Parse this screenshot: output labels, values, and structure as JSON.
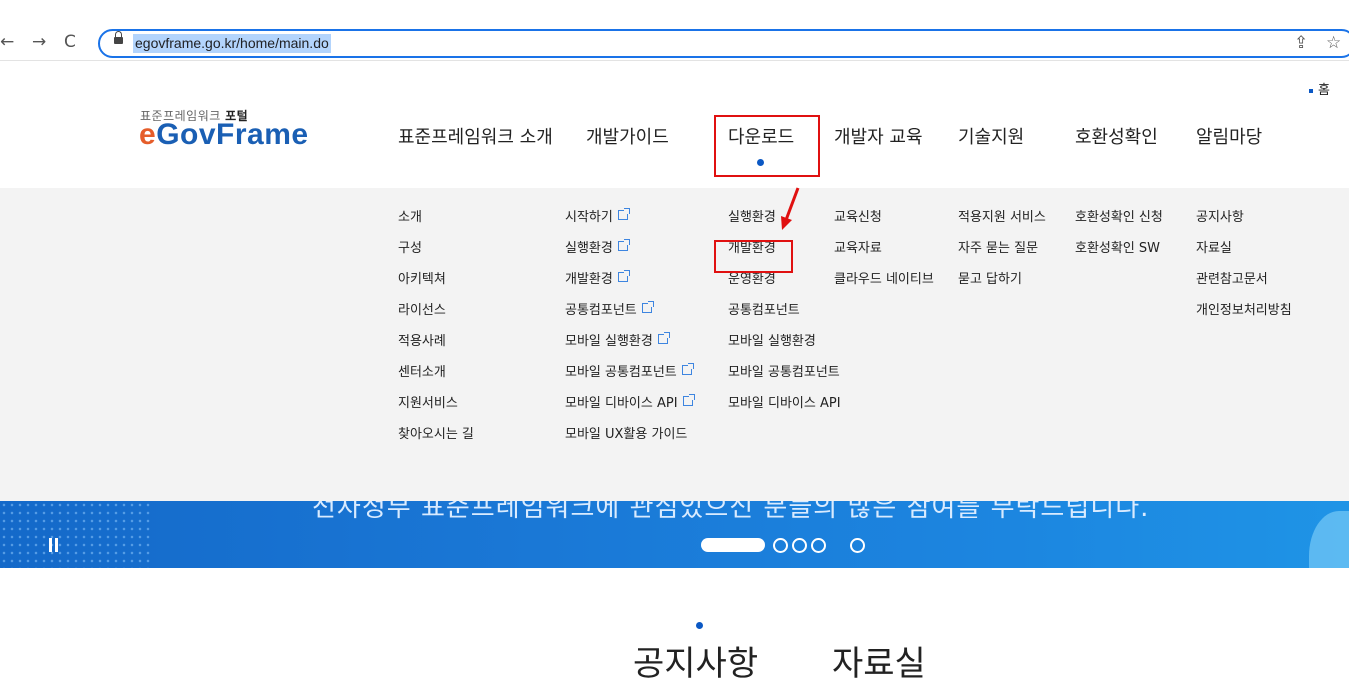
{
  "browser": {
    "url": "egovframe.go.kr/home/main.do"
  },
  "header": {
    "home_link": "홈",
    "logo_subtitle": "표준프레임워크",
    "logo_subtitle_bold": "포털",
    "logo_e": "e",
    "logo_rest": "GovFrame"
  },
  "gnb": [
    {
      "label": "표준프레임워크 소개"
    },
    {
      "label": "개발가이드"
    },
    {
      "label": "다운로드"
    },
    {
      "label": "개발자 교육"
    },
    {
      "label": "기술지원"
    },
    {
      "label": "호환성확인"
    },
    {
      "label": "알림마당"
    }
  ],
  "submenu": {
    "intro": [
      "소개",
      "구성",
      "아키텍쳐",
      "라이선스",
      "적용사례",
      "센터소개",
      "지원서비스",
      "찾아오시는 길"
    ],
    "guide": [
      "시작하기",
      "실행환경",
      "개발환경",
      "공통컴포넌트",
      "모바일 실행환경",
      "모바일 공통컴포넌트",
      "모바일 디바이스 API",
      "모바일 UX활용 가이드"
    ],
    "download": [
      "실행환경",
      "개발환경",
      "운영환경",
      "공통컴포넌트",
      "모바일 실행환경",
      "모바일 공통컴포넌트",
      "모바일 디바이스 API"
    ],
    "education": [
      "교육신청",
      "교육자료",
      "클라우드 네이티브"
    ],
    "support": [
      "적용지원 서비스",
      "자주 묻는 질문",
      "묻고 답하기"
    ],
    "compat": [
      "호환성확인 신청",
      "호환성확인 SW"
    ],
    "notice": [
      "공지사항",
      "자료실",
      "관련참고문서",
      "개인정보처리방침"
    ]
  },
  "banner": {
    "text": "전자정부 표준프레임워크에 관심있으신 분들의 많은 참여를 부탁드립니다."
  },
  "tabs": [
    {
      "label": "공지사항"
    },
    {
      "label": "자료실"
    }
  ],
  "colors": {
    "accent": "#0b58c4",
    "highlight_box": "#e01010",
    "banner": "#1a78d6"
  }
}
